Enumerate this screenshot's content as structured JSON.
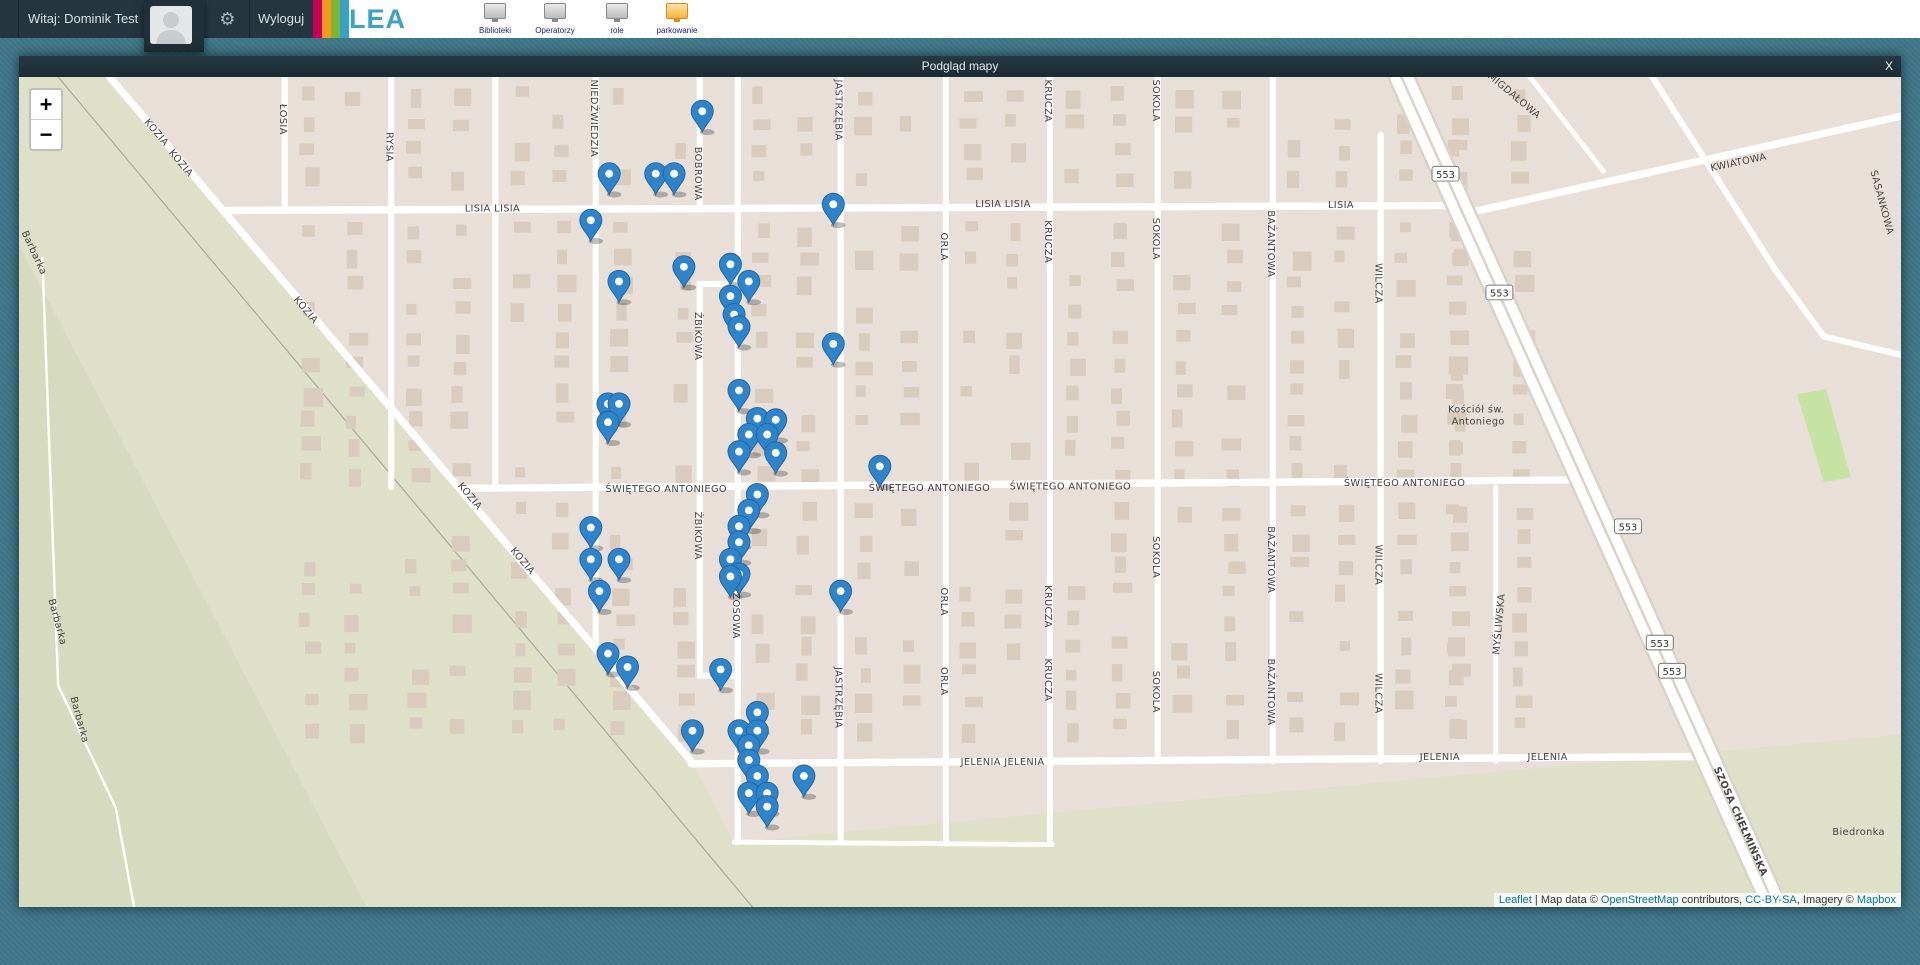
{
  "header": {
    "welcome": "Witaj: Dominik Test",
    "logout": "Wyloguj",
    "logo": "LEA",
    "logo_colors": [
      "#c8005a",
      "#f39a1e",
      "#7ab533",
      "#36a2c6"
    ],
    "nav": [
      {
        "label": "Biblioteki",
        "active": false
      },
      {
        "label": "Operatorzy",
        "active": false
      },
      {
        "label": "role",
        "active": false
      },
      {
        "label": "parkowanie",
        "active": true
      }
    ]
  },
  "window": {
    "title": "Podgląd mapy",
    "close": "X"
  },
  "map": {
    "zoom_in": "+",
    "zoom_out": "−",
    "attribution": {
      "leaflet": "Leaflet",
      "sep": " | Map data © ",
      "osm": "OpenStreetMap",
      "contrib": " contributors, ",
      "license": "CC-BY-SA",
      "imagery": ", Imagery © ",
      "mapbox": "Mapbox"
    },
    "labels": {
      "kozia": "KOZIA",
      "losia": "ŁOSIA",
      "rysia": "RYSIA",
      "lisia": "LISIA",
      "lisia2": "LISIA LISIA",
      "bobrowa": "BOBROWA",
      "niedzwiedzia": "NIEDŹWIEDZIA",
      "zbikowa": "ŻBIKOWA",
      "wrzosowa": "WRZOSOWA",
      "jastrzebia": "JASTRZĘBIA",
      "orla": "ORLA",
      "krucza": "KRUCZA",
      "sokola": "SOKOLA",
      "bazantowa": "BAŻANTOWA",
      "wilcza": "WILCZA",
      "antoniego": "ŚWIĘTEGO ANTONIEGO",
      "jelenia": "JELENIA",
      "jelenia2": "JELENIA JELENIA",
      "myśliwska": "MYŚLIWSKA",
      "szosa": "SZOSA CHEŁMIŃSKA",
      "kwiatowa": "KWIATOWA",
      "sasankowa": "SASANKOWA",
      "migdalowa": "MIGDAŁOWA",
      "barbarka": "Barbarka",
      "kosciol1": "Kościół św.",
      "kosciol2": "Antoniego",
      "biedronka": "Biedronka",
      "road553": "553"
    },
    "marker_count": 51
  }
}
